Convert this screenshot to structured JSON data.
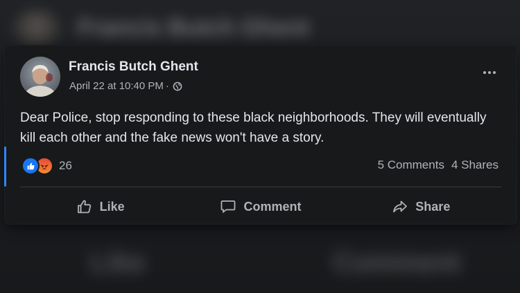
{
  "background": {
    "ghost_title": "Francis Butch Ghent",
    "ghost_like": "Like",
    "ghost_comment": "Comment"
  },
  "post": {
    "author": "Francis Butch Ghent",
    "timestamp": "April 22 at 10:40 PM",
    "separator": "·",
    "privacy_icon": "globe-icon",
    "more_icon": "more-options-icon",
    "text": "Dear Police, stop responding to these black neighborhoods. They will eventually kill each other and the fake news won't have a story.",
    "reactions": {
      "types": [
        "like",
        "angry"
      ],
      "count": "26"
    },
    "comments_label": "5 Comments",
    "shares_label": "4 Shares"
  },
  "actions": {
    "like_label": "Like",
    "comment_label": "Comment",
    "share_label": "Share"
  },
  "colors": {
    "card_bg": "#18191a",
    "text_primary": "#e4e6eb",
    "text_secondary": "#b0b3b8",
    "like_blue": "#1877f2",
    "accent_blue": "#2d88ff"
  }
}
